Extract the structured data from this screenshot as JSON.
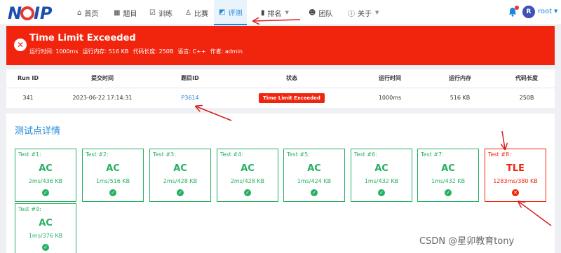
{
  "nav": {
    "logo_text": "NOIP",
    "items": [
      {
        "label": "首页",
        "icon": "home-icon"
      },
      {
        "label": "题目",
        "icon": "grid-icon"
      },
      {
        "label": "训练",
        "icon": "clipboard-check-icon"
      },
      {
        "label": "比赛",
        "icon": "trophy-icon"
      },
      {
        "label": "评测",
        "icon": "chart-icon",
        "active": true
      },
      {
        "label": "排名",
        "icon": "bar-chart-icon"
      },
      {
        "label": "团队",
        "icon": "group-icon"
      },
      {
        "label": "关于",
        "icon": "info-icon"
      }
    ],
    "user_initial": "R",
    "user_name": "root"
  },
  "banner": {
    "title": "Time Limit Exceeded",
    "details": [
      "运行时间: 1000ms",
      "运行内存: 516 KB",
      "代码长度: 250B",
      "语言: C++",
      "作者: admin"
    ]
  },
  "submission": {
    "headers": [
      "Run ID",
      "提交时间",
      "题目ID",
      "状态",
      "运行时间",
      "运行内存",
      "代码长度"
    ],
    "run_id": "341",
    "submit_time": "2023-06-22 17:14:31",
    "problem_id": "P3614",
    "status": "Time Limit Exceeded",
    "run_time": "1000ms",
    "memory": "516 KB",
    "code_length": "250B"
  },
  "tests": {
    "title": "测试点详情",
    "items": [
      {
        "label": "Test #1:",
        "result": "AC",
        "usage": "2ms/436 KB",
        "status": "pass"
      },
      {
        "label": "Test #2:",
        "result": "AC",
        "usage": "1ms/516 KB",
        "status": "pass"
      },
      {
        "label": "Test #3:",
        "result": "AC",
        "usage": "2ms/428 KB",
        "status": "pass"
      },
      {
        "label": "Test #4:",
        "result": "AC",
        "usage": "2ms/428 KB",
        "status": "pass"
      },
      {
        "label": "Test #5:",
        "result": "AC",
        "usage": "1ms/424 KB",
        "status": "pass"
      },
      {
        "label": "Test #6:",
        "result": "AC",
        "usage": "1ms/432 KB",
        "status": "pass"
      },
      {
        "label": "Test #7:",
        "result": "AC",
        "usage": "1ms/432 KB",
        "status": "pass"
      },
      {
        "label": "Test #8:",
        "result": "TLE",
        "usage": "1283ms/380 KB",
        "status": "fail"
      },
      {
        "label": "Test #9:",
        "result": "AC",
        "usage": "1ms/376 KB",
        "status": "pass"
      }
    ]
  },
  "watermark": "CSDN @星卯教育tony",
  "colors": {
    "accent": "#1e88d8",
    "error": "#f1240d",
    "success": "#26b062"
  }
}
